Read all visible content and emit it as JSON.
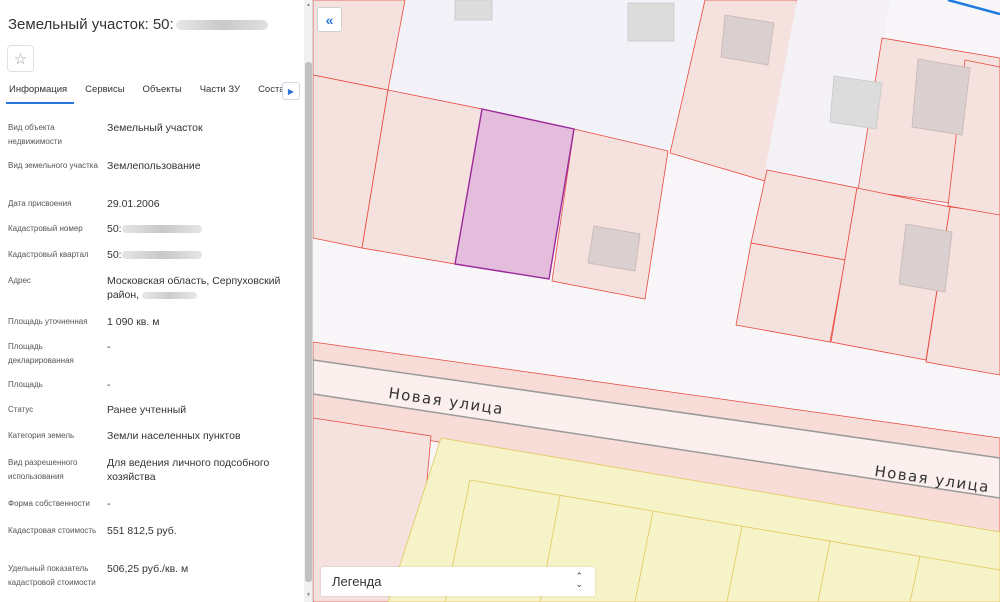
{
  "panel": {
    "title": "Земельный участок: 50:",
    "star_icon": "star-icon",
    "tabs": [
      {
        "label": "Информация",
        "active": true
      },
      {
        "label": "Сервисы",
        "active": false
      },
      {
        "label": "Объекты",
        "active": false
      },
      {
        "label": "Части ЗУ",
        "active": false
      },
      {
        "label": "Соста",
        "active": false
      }
    ],
    "rows": [
      {
        "key": "Вид объекта недвижимости",
        "value": "Земельный участок"
      },
      {
        "key": "Вид земельного участка",
        "value": "Землепользование"
      },
      {
        "key": "Дата присвоения",
        "value": "29.01.2006"
      },
      {
        "key": "Кадастровый номер",
        "value": "50:"
      },
      {
        "key": "Кадастровый квартал",
        "value": "50:"
      },
      {
        "key": "Адрес",
        "value": "Московская область, Серпуховский район,"
      },
      {
        "key": "Площадь уточненная",
        "value": "1 090 кв. м"
      },
      {
        "key": "Площадь декларированная",
        "value": "-"
      },
      {
        "key": "Площадь",
        "value": "-"
      },
      {
        "key": "Статус",
        "value": "Ранее учтенный"
      },
      {
        "key": "Категория земель",
        "value": "Земли населенных пунктов"
      },
      {
        "key": "Вид разрешенного использования",
        "value": "Для ведения личного подсобного хозяйства"
      },
      {
        "key": "Форма собственности",
        "value": "-"
      },
      {
        "key": "Кадастровая стоимость",
        "value": "551 812,5 руб."
      },
      {
        "key": "Удельный показатель кадастровой стоимости",
        "value": "506,25 руб./кв. м"
      }
    ]
  },
  "map": {
    "collapse_icon": "double-chevron-left-icon",
    "street_label_1": "Новая  улица",
    "street_label_2": "Новая  улица",
    "legend_label": "Легенда",
    "legend_toggle_icon": "up-down-chevron-icon",
    "colors": {
      "parcel_fill": "#f5e1de",
      "parcel_stroke": "#e8493f",
      "selected_fill": "#e4bcdc",
      "selected_stroke": "#9b2a9b",
      "building_fill": "#d9d0cf",
      "gray_building": "#dcdcdc",
      "road_fill": "#f7dcd7",
      "yellow_zone": "#f7f3c9",
      "blue_line": "#1e7be0"
    }
  }
}
